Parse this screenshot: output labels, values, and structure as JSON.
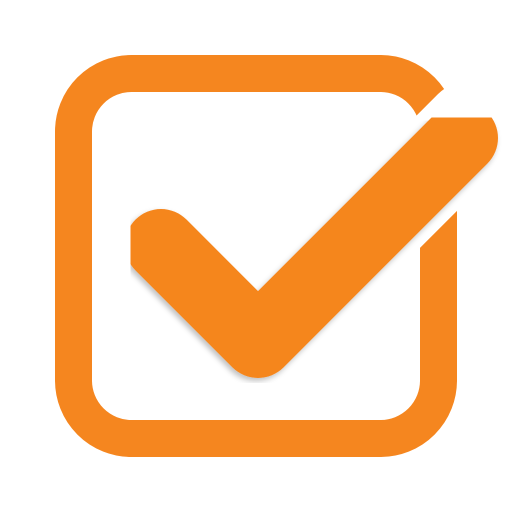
{
  "icon": {
    "name": "checked-checkbox-icon",
    "accent_color": "#F5861F",
    "background_color": "#FFFFFF"
  }
}
